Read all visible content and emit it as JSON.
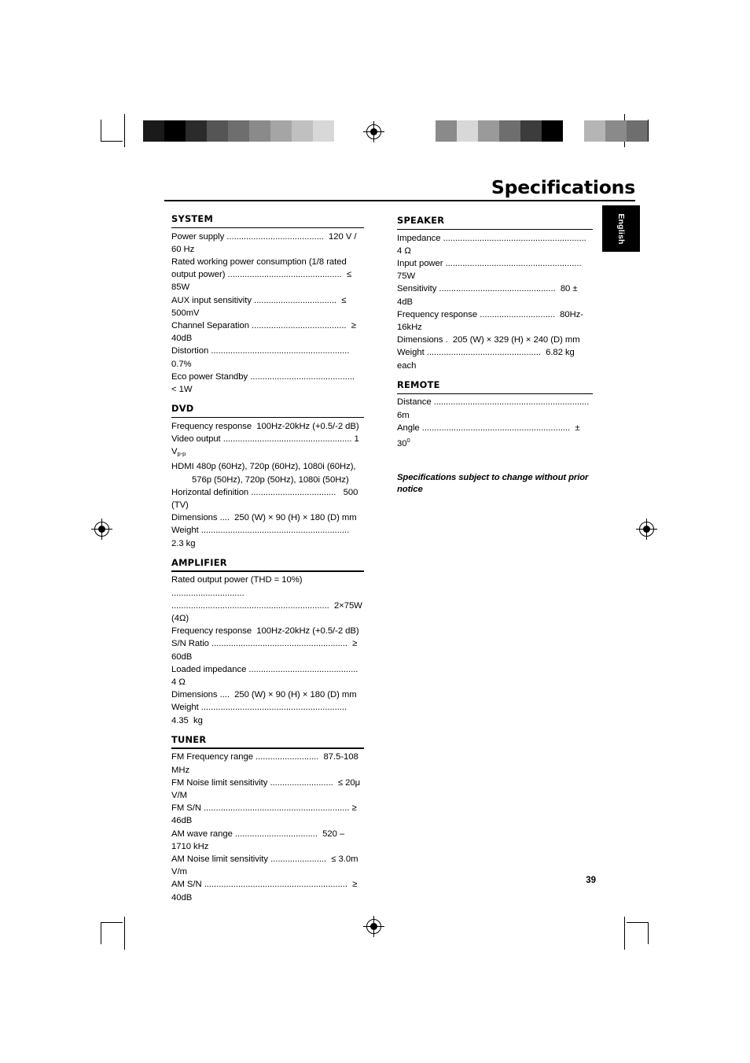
{
  "header": {
    "title": "Specifications",
    "side_tab": "English"
  },
  "page_number": "39",
  "sections": {
    "left": [
      {
        "heading": "SYSTEM",
        "lines": [
          "Power supply ........................................  120 V / 60 Hz",
          "Rated working power consumption (1/8 rated",
          "output power) ...............................................  ≤ 85W",
          "AUX input sensitivity ..................................  ≤ 500mV",
          "Channel Separation .......................................  ≥ 40dB",
          "Distortion .........................................................  0.7%",
          "Eco power Standby ...........................................  < 1W"
        ]
      },
      {
        "heading": "DVD",
        "lines": [
          "Frequency response  100Hz-20kHz (+0.5/-2 dB)",
          "Video output ..................................................... 1 V",
          "HDMI 480p (60Hz), 720p (60Hz), 1080i (60Hz),",
          "576p (50Hz), 720p (50Hz), 1080i (50Hz)",
          "Horizontal definition ...................................   500 (TV)",
          "Dimensions ....  250 (W) × 90 (H) × 180 (D) mm",
          "Weight .............................................................  2.3 kg"
        ],
        "video_output_sub": "p-p",
        "indent_lines": [
          3
        ]
      },
      {
        "heading": "AMPLIFIER",
        "lines": [
          "Rated output power (THD = 10%) ..............................",
          ".................................................................  2×75W (4Ω)",
          "Frequency response  100Hz-20kHz (+0.5/-2 dB)",
          "S/N Ratio ........................................................  ≥ 60dB",
          "Loaded impedance ............................................. 4 Ω",
          "Dimensions ....  250 (W) × 90 (H) × 180 (D) mm",
          "Weight ............................................................  4.35  kg"
        ]
      },
      {
        "heading": "TUNER",
        "lines": [
          "FM Frequency range ..........................  87.5-108 MHz",
          "FM Noise limit sensitivity ..........................  ≤ 20μ V/M",
          "FM S/N ............................................................ ≥ 46dB",
          "AM wave range ..................................  520 – 1710 kHz",
          "AM Noise limit sensitivity .......................  ≤ 3.0m V/m",
          "AM S/N ...........................................................  ≥ 40dB"
        ]
      }
    ],
    "right": [
      {
        "heading": "SPEAKER",
        "lines": [
          "Impedance ...........................................................  4 Ω",
          "Input power ........................................................  75W",
          "Sensitivity ................................................  80 ± 4dB",
          "Frequency response ...............................  80Hz-16kHz",
          "Dimensions .  205 (W) × 329 (H) × 240 (D) mm",
          "Weight ...............................................  6.82 kg each"
        ]
      },
      {
        "heading": "REMOTE",
        "lines": [
          "Distance ................................................................  6m",
          "Angle .............................................................  ± 30"
        ],
        "angle_sup": "0"
      }
    ],
    "note": "Specifications subject to change without prior notice"
  },
  "print_marks": {
    "swatches_left": [
      "#1a1a1a",
      "#000000",
      "#2b2b2b",
      "#555555",
      "#6e6e6e",
      "#8a8a8a",
      "#a5a5a5",
      "#c0c0c0",
      "#d8d8d8",
      "#ffffff"
    ],
    "swatches_right": [
      "#ffffff",
      "#8a8a8a",
      "#d8d8d8",
      "#9a9a9a",
      "#6e6e6e",
      "#3c3c3c",
      "#000000",
      "#ffffff",
      "#b5b5b5",
      "#8a8a8a",
      "#6e6e6e"
    ]
  }
}
